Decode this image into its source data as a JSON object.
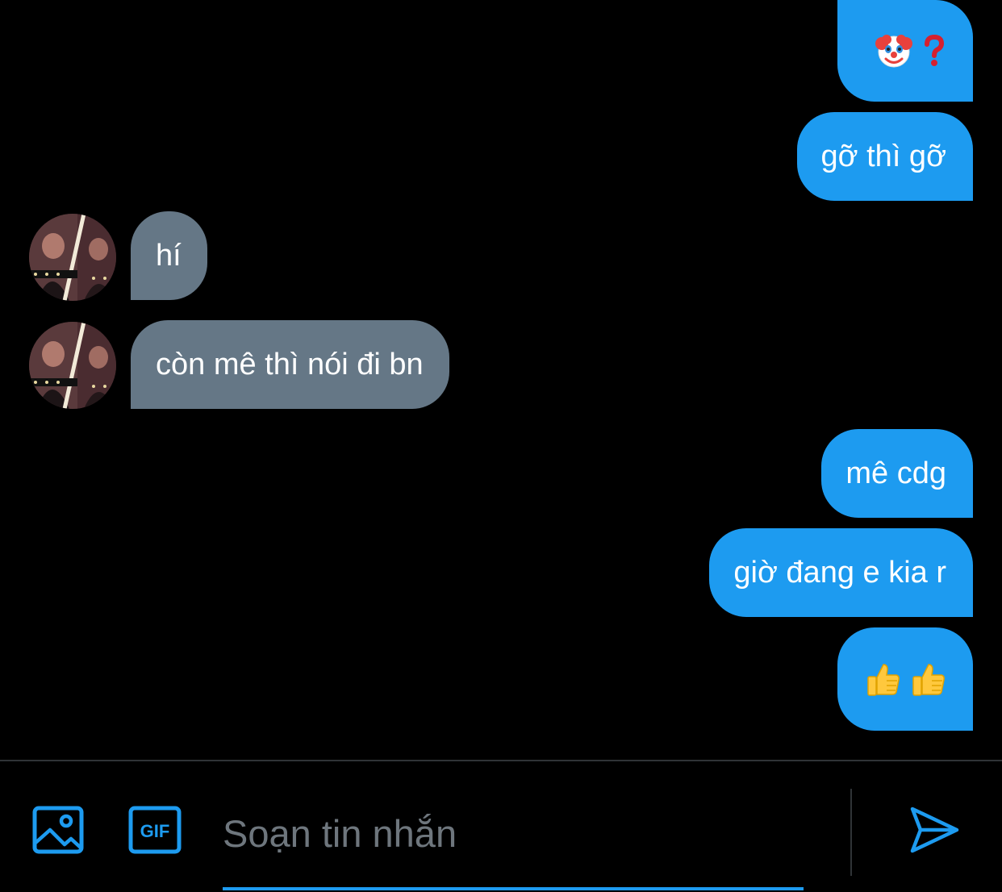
{
  "colors": {
    "background": "#000000",
    "sent_bubble": "#1d9bf0",
    "received_bubble": "#657786",
    "accent": "#1d9bf0",
    "placeholder": "#6e767d",
    "divider": "#2f3336"
  },
  "messages": [
    {
      "direction": "sent",
      "text": "🤡 ❓"
    },
    {
      "direction": "sent",
      "text": "gỡ thì gỡ"
    },
    {
      "direction": "received",
      "text": "hí",
      "avatar_icon": "avatar-photo"
    },
    {
      "direction": "received",
      "text": "còn mê thì nói đi bn",
      "avatar_icon": "avatar-photo"
    },
    {
      "direction": "sent",
      "text": "mê cdg"
    },
    {
      "direction": "sent",
      "text": "giờ đang e kia r"
    },
    {
      "direction": "sent",
      "text": "👍 👍"
    }
  ],
  "composer": {
    "image_icon": "image-icon",
    "gif_icon": "gif-icon",
    "gif_label": "GIF",
    "placeholder": "Soạn tin nhắn",
    "value": "",
    "send_icon": "send-icon"
  }
}
